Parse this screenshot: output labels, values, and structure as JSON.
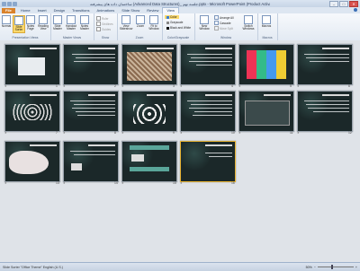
{
  "app": {
    "title": "ساختمان داده های پیشرفته (Advanced Data Structures)_ جلسه نهم.pptx - Microsoft PowerPoint (Product Activation Failed)"
  },
  "window": {
    "minimize": "–",
    "maximize": "□",
    "close": "✕"
  },
  "tabs": [
    "File",
    "Home",
    "Insert",
    "Design",
    "Transitions",
    "Animations",
    "Slide Show",
    "Review",
    "View"
  ],
  "ribbon": {
    "views_group": "Presentation Views",
    "normal": "Normal",
    "slide_sorter": "Slide Sorter",
    "notes_page": "Notes Page",
    "reading_view": "Reading View",
    "master_group": "Master Views",
    "slide_master": "Slide Master",
    "handout_master": "Handout Master",
    "notes_master": "Notes Master",
    "show_group": "Show",
    "ruler": "Ruler",
    "gridlines": "Gridlines",
    "guides": "Guides",
    "zoom_group": "Zoom",
    "view_slideshow": "View Slideshow",
    "zoom": "Zoom",
    "fit_to_window": "Fit to Window",
    "color_group": "Color/Grayscale",
    "color": "Color",
    "grayscale": "Grayscale",
    "black_white": "Black and White",
    "window_group": "Window",
    "new_window": "New Window",
    "arrange_all": "Arrange All",
    "cascade": "Cascade",
    "move_split": "Move Split",
    "switch_windows": "Switch Windows",
    "macros_group": "Macros",
    "macros": "Macros"
  },
  "slides": [
    {
      "num": "1"
    },
    {
      "num": "2"
    },
    {
      "num": "3"
    },
    {
      "num": "4"
    },
    {
      "num": "5"
    },
    {
      "num": "6"
    },
    {
      "num": "7"
    },
    {
      "num": "8"
    },
    {
      "num": "9"
    },
    {
      "num": "10"
    },
    {
      "num": "11"
    },
    {
      "num": "12"
    },
    {
      "num": "13"
    },
    {
      "num": "14"
    },
    {
      "num": "15"
    },
    {
      "num": "16"
    }
  ],
  "status": {
    "left": "Slide Sorter  \"Office Theme\"  English (U.S.)",
    "zoom": "50%"
  },
  "colors": {
    "accent": "#d9822b",
    "selected_border": "#e6b233",
    "slide_bg": "#1d2a2c"
  }
}
